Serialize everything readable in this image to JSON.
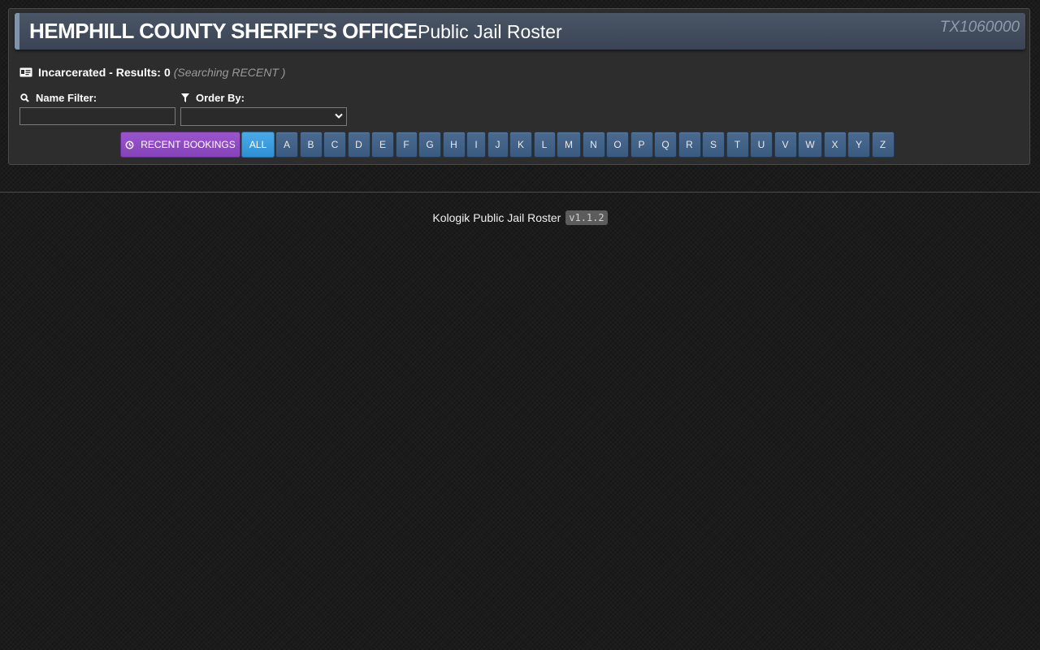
{
  "header": {
    "agency_name": "HEMPHILL COUNTY SHERIFF'S OFFICE",
    "roster_title": "Public Jail Roster",
    "agency_id": "TX1060000"
  },
  "results": {
    "label": "Incarcerated - Results:",
    "count": "0",
    "searching": "(Searching RECENT )",
    "icon": "id-card-icon"
  },
  "filters": {
    "name_label": "Name Filter:",
    "name_value": "",
    "name_icon": "search-icon",
    "order_label": "Order By:",
    "order_value": "",
    "order_icon": "filter-icon"
  },
  "buttons": {
    "recent_label": "RECENT BOOKINGS",
    "recent_icon": "clock-icon",
    "all_label": "ALL",
    "letters": [
      "A",
      "B",
      "C",
      "D",
      "E",
      "F",
      "G",
      "H",
      "I",
      "J",
      "K",
      "L",
      "M",
      "N",
      "O",
      "P",
      "Q",
      "R",
      "S",
      "T",
      "U",
      "V",
      "W",
      "X",
      "Y",
      "Z"
    ]
  },
  "footer": {
    "text": "Kologik Public Jail Roster",
    "version": "v1.1.2"
  },
  "colors": {
    "recent_button": "#8b48bf",
    "all_button": "#3a9ade",
    "letter_button": "#3f6088",
    "header_bar": "#434e5e"
  }
}
